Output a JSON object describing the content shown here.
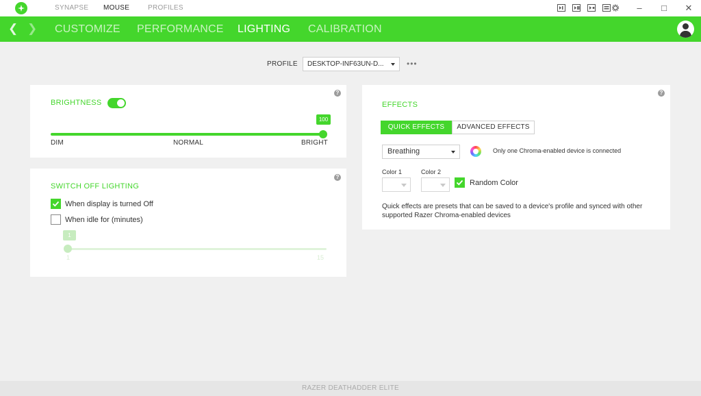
{
  "titlebar": {
    "nav": [
      "SYNAPSE",
      "MOUSE",
      "PROFILES"
    ],
    "active": "MOUSE"
  },
  "tabs": [
    "CUSTOMIZE",
    "PERFORMANCE",
    "LIGHTING",
    "CALIBRATION"
  ],
  "active_tab": "LIGHTING",
  "profile": {
    "label": "PROFILE",
    "value": "DESKTOP-INF63UN-D...",
    "more": "•••"
  },
  "brightness": {
    "title": "BRIGHTNESS",
    "enabled": true,
    "value": "100",
    "level": 1.0,
    "labels": {
      "min": "DIM",
      "mid": "NORMAL",
      "max": "BRIGHT"
    }
  },
  "switch_off": {
    "title": "SWITCH OFF LIGHTING",
    "display_off_label": "When display is turned Off",
    "display_off_checked": true,
    "idle_label": "When idle for (minutes)",
    "idle_checked": false,
    "idle_value": "1",
    "idle_min": "1",
    "idle_max": "15"
  },
  "effects": {
    "title": "EFFECTS",
    "quick_tab": "QUICK EFFECTS",
    "advanced_tab": "ADVANCED EFFECTS",
    "selected_effect": "Breathing",
    "info": "Only one Chroma-enabled device is connected",
    "color1_label": "Color 1",
    "color2_label": "Color 2",
    "random_color_label": "Random Color",
    "random_color_checked": true,
    "description": "Quick effects are presets that can be saved to a device's profile and synced with other supported Razer Chroma-enabled devices"
  },
  "help_glyph": "?",
  "footer": {
    "device": "RAZER DEATHADDER ELITE"
  },
  "colors": {
    "accent": "#44d62c"
  }
}
